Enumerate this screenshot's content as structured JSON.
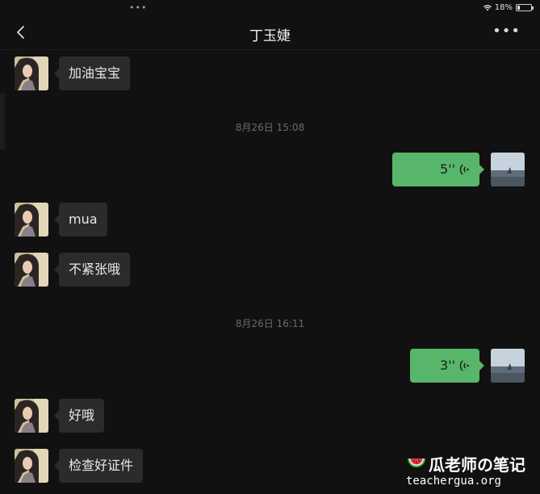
{
  "status_bar": {
    "dots": "•••",
    "battery_text": "18%",
    "battery_level": 0.18
  },
  "header": {
    "title": "丁玉婕"
  },
  "messages": [
    {
      "type": "text",
      "side": "in",
      "text": "加油宝宝"
    },
    {
      "type": "time",
      "text": "8月26日 15:08"
    },
    {
      "type": "voice",
      "side": "out",
      "duration": "5''"
    },
    {
      "type": "text",
      "side": "in",
      "text": "mua"
    },
    {
      "type": "text",
      "side": "in",
      "text": "不紧张哦"
    },
    {
      "type": "time",
      "text": "8月26日 16:11"
    },
    {
      "type": "voice",
      "side": "out",
      "duration": "3''"
    },
    {
      "type": "text",
      "side": "in",
      "text": "好哦"
    },
    {
      "type": "text",
      "side": "in",
      "text": "检查好证件"
    }
  ],
  "watermark": {
    "title": "瓜老师の笔记",
    "url": "teachergua.org"
  },
  "colors": {
    "background": "#111111",
    "incoming_bubble": "#2b2b2b",
    "outgoing_bubble": "#58b66a",
    "timestamp": "#6b6b6b"
  },
  "icons": [
    "back-chevron-icon",
    "more-dots-icon",
    "wifi-icon",
    "battery-icon",
    "voice-wave-icon",
    "watermelon-icon"
  ]
}
